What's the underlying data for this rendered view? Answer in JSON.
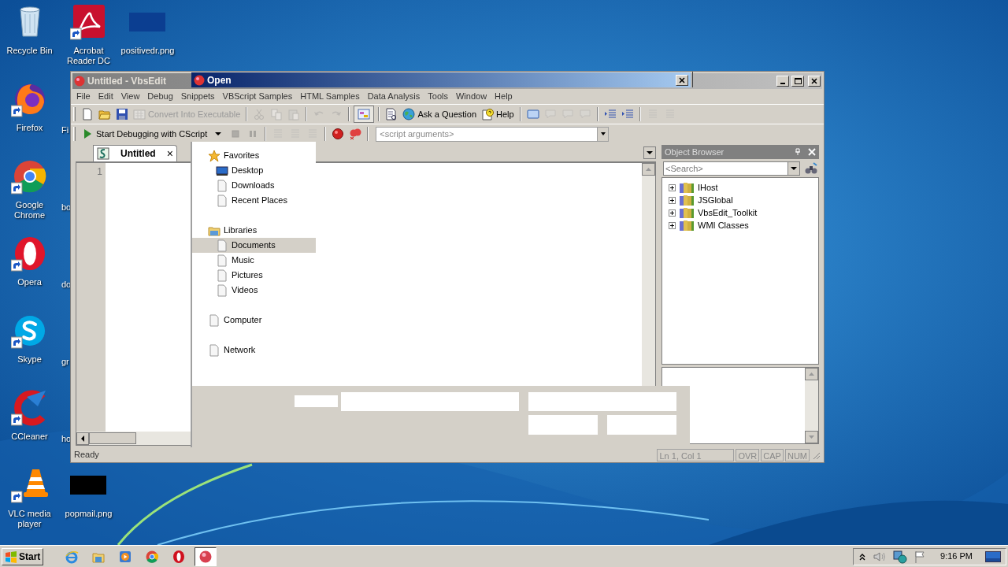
{
  "desktop": {
    "columns": [
      [
        {
          "label": "Recycle Bin",
          "kind": "bin",
          "shortcut": false
        },
        {
          "label": "Firefox",
          "kind": "firefox",
          "shortcut": true
        },
        {
          "label": "Google Chrome",
          "kind": "chrome",
          "shortcut": true
        },
        {
          "label": "Opera",
          "kind": "opera",
          "shortcut": true
        },
        {
          "label": "Skype",
          "kind": "skype",
          "shortcut": true
        },
        {
          "label": "CCleaner",
          "kind": "ccleaner",
          "shortcut": true
        },
        {
          "label": "VLC media player",
          "kind": "vlc",
          "shortcut": true
        }
      ],
      [
        {
          "label": "Acrobat Reader DC",
          "kind": "acrobat",
          "shortcut": true
        },
        {
          "label": "Fi",
          "kind": "covered"
        },
        {
          "label": "bo",
          "kind": "covered"
        },
        {
          "label": "do",
          "kind": "covered"
        },
        {
          "label": "gr",
          "kind": "covered"
        },
        {
          "label": "ho",
          "kind": "covered"
        },
        {
          "label": "popmail.png",
          "kind": "thumb",
          "color": "#000000",
          "shortcut": false
        }
      ],
      [
        {
          "label": "positivedr.png",
          "kind": "thumb",
          "color": "#0b3e91",
          "shortcut": false
        }
      ]
    ]
  },
  "vbsedit": {
    "title": "Untitled - VbsEdit",
    "menu": [
      "File",
      "Edit",
      "View",
      "Debug",
      "Snippets",
      "VBScript Samples",
      "HTML Samples",
      "Data Analysis",
      "Tools",
      "Window",
      "Help"
    ],
    "toolbar": [
      {
        "kind": "new",
        "disabled": false
      },
      {
        "kind": "open",
        "disabled": false
      },
      {
        "kind": "save",
        "disabled": false
      },
      {
        "kind": "convert",
        "label": "Convert Into Executable",
        "disabled": true
      },
      {
        "kind": "separator"
      },
      {
        "kind": "cut",
        "disabled": true
      },
      {
        "kind": "copy",
        "disabled": true
      },
      {
        "kind": "paste",
        "disabled": true
      },
      {
        "kind": "separator"
      },
      {
        "kind": "undo",
        "disabled": true
      },
      {
        "kind": "redo",
        "disabled": true
      },
      {
        "kind": "separator"
      },
      {
        "kind": "options",
        "disabled": false
      },
      {
        "kind": "separator"
      },
      {
        "kind": "docsearch",
        "disabled": false
      },
      {
        "kind": "ask",
        "label": "Ask a Question",
        "disabled": false
      },
      {
        "kind": "help",
        "label": "Help",
        "disabled": false
      },
      {
        "kind": "separator"
      },
      {
        "kind": "window",
        "disabled": false
      },
      {
        "kind": "bubble",
        "disabled": true
      },
      {
        "kind": "bubble",
        "disabled": true
      },
      {
        "kind": "bubble",
        "disabled": true
      },
      {
        "kind": "separator"
      },
      {
        "kind": "indent",
        "disabled": false
      },
      {
        "kind": "indent",
        "disabled": false
      },
      {
        "kind": "separator"
      },
      {
        "kind": "lines",
        "disabled": true
      },
      {
        "kind": "lines",
        "disabled": true
      }
    ],
    "debugbar": [
      {
        "kind": "debug",
        "label": "Start Debugging with CScript",
        "disabled": false
      },
      {
        "kind": "caret",
        "disabled": false
      },
      {
        "kind": "stop",
        "disabled": true
      },
      {
        "kind": "pause",
        "disabled": true
      },
      {
        "kind": "separator"
      },
      {
        "kind": "lines",
        "disabled": true
      },
      {
        "kind": "lines",
        "disabled": true
      },
      {
        "kind": "lines",
        "disabled": true
      },
      {
        "kind": "separator"
      },
      {
        "kind": "breakpoint",
        "disabled": false
      },
      {
        "kind": "breakpoints",
        "disabled": false
      },
      {
        "kind": "separator"
      },
      {
        "kind": "field",
        "placeholder": "<script arguments>"
      }
    ],
    "tabs": [
      {
        "label": "Untitled",
        "close": "×",
        "selected": true
      }
    ],
    "line_numbers": [
      "1"
    ],
    "object_browser": {
      "title": "Object Browser",
      "search_placeholder": "<Search>",
      "items": [
        {
          "label": "IHost",
          "expanded": false
        },
        {
          "label": "JSGlobal",
          "expanded": false
        },
        {
          "label": "VbsEdit_Toolkit",
          "expanded": false
        },
        {
          "label": "WMI Classes",
          "expanded": false
        }
      ]
    },
    "status_bar": {
      "message": "Ready",
      "position": "Ln 1, Col 1",
      "indicators": [
        "OVR",
        "CAP",
        "NUM"
      ]
    }
  },
  "open_dialog": {
    "title": "Open",
    "nav": [
      {
        "label": "Favorites",
        "kind": "favorites",
        "selected": false,
        "children": [
          {
            "label": "Desktop",
            "kind": "desktop",
            "selected": false
          },
          {
            "label": "Downloads",
            "kind": "page",
            "selected": false
          },
          {
            "label": "Recent Places",
            "kind": "page",
            "selected": false
          }
        ]
      },
      {
        "label": "Libraries",
        "kind": "libraries",
        "selected": false,
        "children": [
          {
            "label": "Documents",
            "kind": "page",
            "selected": true
          },
          {
            "label": "Music",
            "kind": "page",
            "selected": false
          },
          {
            "label": "Pictures",
            "kind": "page",
            "selected": false
          },
          {
            "label": "Videos",
            "kind": "page",
            "selected": false
          }
        ]
      },
      {
        "label": "Computer",
        "kind": "page",
        "selected": false
      },
      {
        "label": "Network",
        "kind": "page",
        "selected": false
      }
    ]
  },
  "taskbar": {
    "start": "Start",
    "apps": [
      {
        "kind": "ie",
        "active": false
      },
      {
        "kind": "explorer",
        "active": false
      },
      {
        "kind": "media",
        "active": false
      },
      {
        "kind": "chrome",
        "active": false
      },
      {
        "kind": "opera",
        "active": false
      },
      {
        "kind": "vbsedit",
        "active": true
      }
    ],
    "clock": "9:16 PM"
  }
}
